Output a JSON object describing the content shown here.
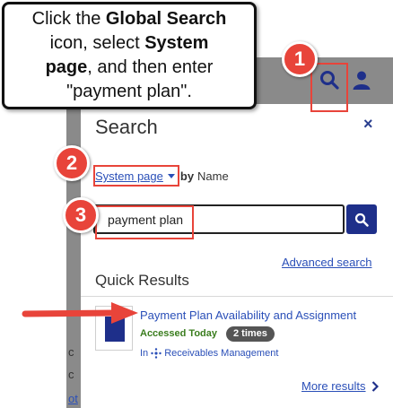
{
  "callout": {
    "line1_prefix": "Click the ",
    "line1_bold": "Global Search",
    "line2_prefix": "icon, select ",
    "line2_bold": "System",
    "line3_bold": "page",
    "line3_suffix": ", and then enter",
    "line4": "\"payment plan\"."
  },
  "steps": {
    "one": "1",
    "two": "2",
    "three": "3"
  },
  "background": {
    "fragment_c1": "c",
    "fragment_c2": "c",
    "fragment_ot": "ot"
  },
  "panel": {
    "title": "Search",
    "close_label": "×",
    "scope_selected": "System page",
    "scope_by": "by",
    "scope_field": "Name",
    "search_value": "payment plan",
    "advanced_search": "Advanced search",
    "quick_results_title": "Quick Results",
    "result": {
      "title": "Payment Plan Availability and Assignment",
      "accessed": "Accessed Today",
      "times": "2 times",
      "in_prefix": "In",
      "in_area": "Receivables Management"
    },
    "more_results": "More results"
  },
  "colors": {
    "accent": "#1e2f8a",
    "link": "#2a4fb8",
    "marker": "#e8443a",
    "accessed": "#3a7d1e",
    "header": "#8a8a8a"
  }
}
